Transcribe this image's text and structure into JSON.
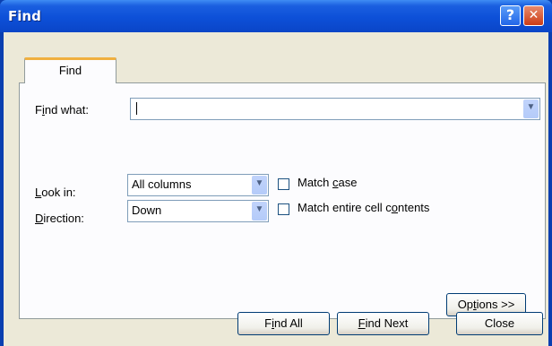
{
  "window": {
    "title": "Find",
    "help_label": "?",
    "close_label": "✕"
  },
  "tabs": [
    {
      "label": "Find",
      "active": true
    }
  ],
  "find_what": {
    "label_pre": "F",
    "label_u": "i",
    "label_post": "nd what:",
    "value": ""
  },
  "look_in": {
    "label_pre": "",
    "label_u": "L",
    "label_post": "ook in:",
    "value": "All columns"
  },
  "direction": {
    "label_pre": "",
    "label_u": "D",
    "label_post": "irection:",
    "value": "Down"
  },
  "match_case": {
    "label_pre": "Match ",
    "label_u": "c",
    "label_post": "ase",
    "checked": false
  },
  "match_entire": {
    "label_pre": "Match entire cell c",
    "label_u": "o",
    "label_post": "ntents",
    "checked": false
  },
  "buttons": {
    "options": {
      "pre": "Op",
      "u": "t",
      "post": "ions >>"
    },
    "find_all": {
      "pre": "F",
      "u": "i",
      "post": "nd All"
    },
    "find_next": {
      "pre": "",
      "u": "F",
      "post": "ind Next"
    },
    "close": {
      "label": "Close"
    }
  },
  "icons": {
    "dropdown_arrow": "chevron-down-icon",
    "help": "question-mark-icon",
    "close": "close-icon"
  },
  "colors": {
    "titlebar": "#0d50d8",
    "tab_highlight": "#f0b040",
    "dialog_bg": "#ece9d8",
    "panel_bg": "#fcfcfe"
  }
}
